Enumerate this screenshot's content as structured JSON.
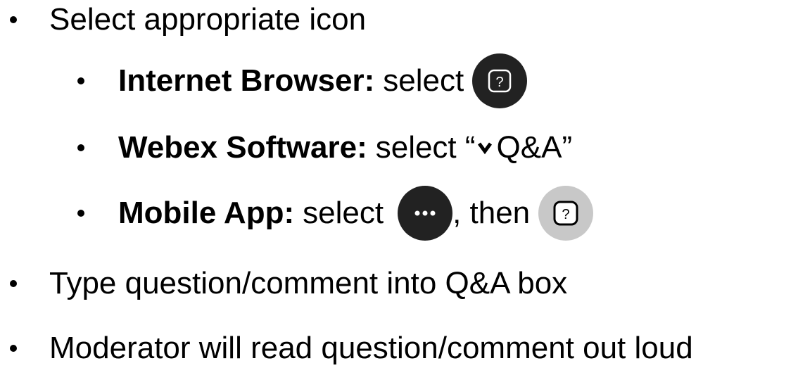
{
  "bullets": {
    "b1": "Select appropriate icon",
    "b1_1_label": "Internet Browser:",
    "b1_1_text": "select",
    "b1_2_label": "Webex Software:",
    "b1_2_text_before": "select “",
    "b1_2_text_after": "Q&A”",
    "b1_3_label": "Mobile App:",
    "b1_3_text": "select",
    "b1_3_then": ", then",
    "b2": "Type question/comment into Q&A box",
    "b3": "Moderator will read question/comment out loud"
  },
  "icons": {
    "browser": "question-icon",
    "chevron": "chevron-down-icon",
    "more": "more-options-icon",
    "mobile_question": "question-icon"
  },
  "colors": {
    "dark_icon_bg": "#222222",
    "light_icon_bg": "#c8c8c8"
  }
}
